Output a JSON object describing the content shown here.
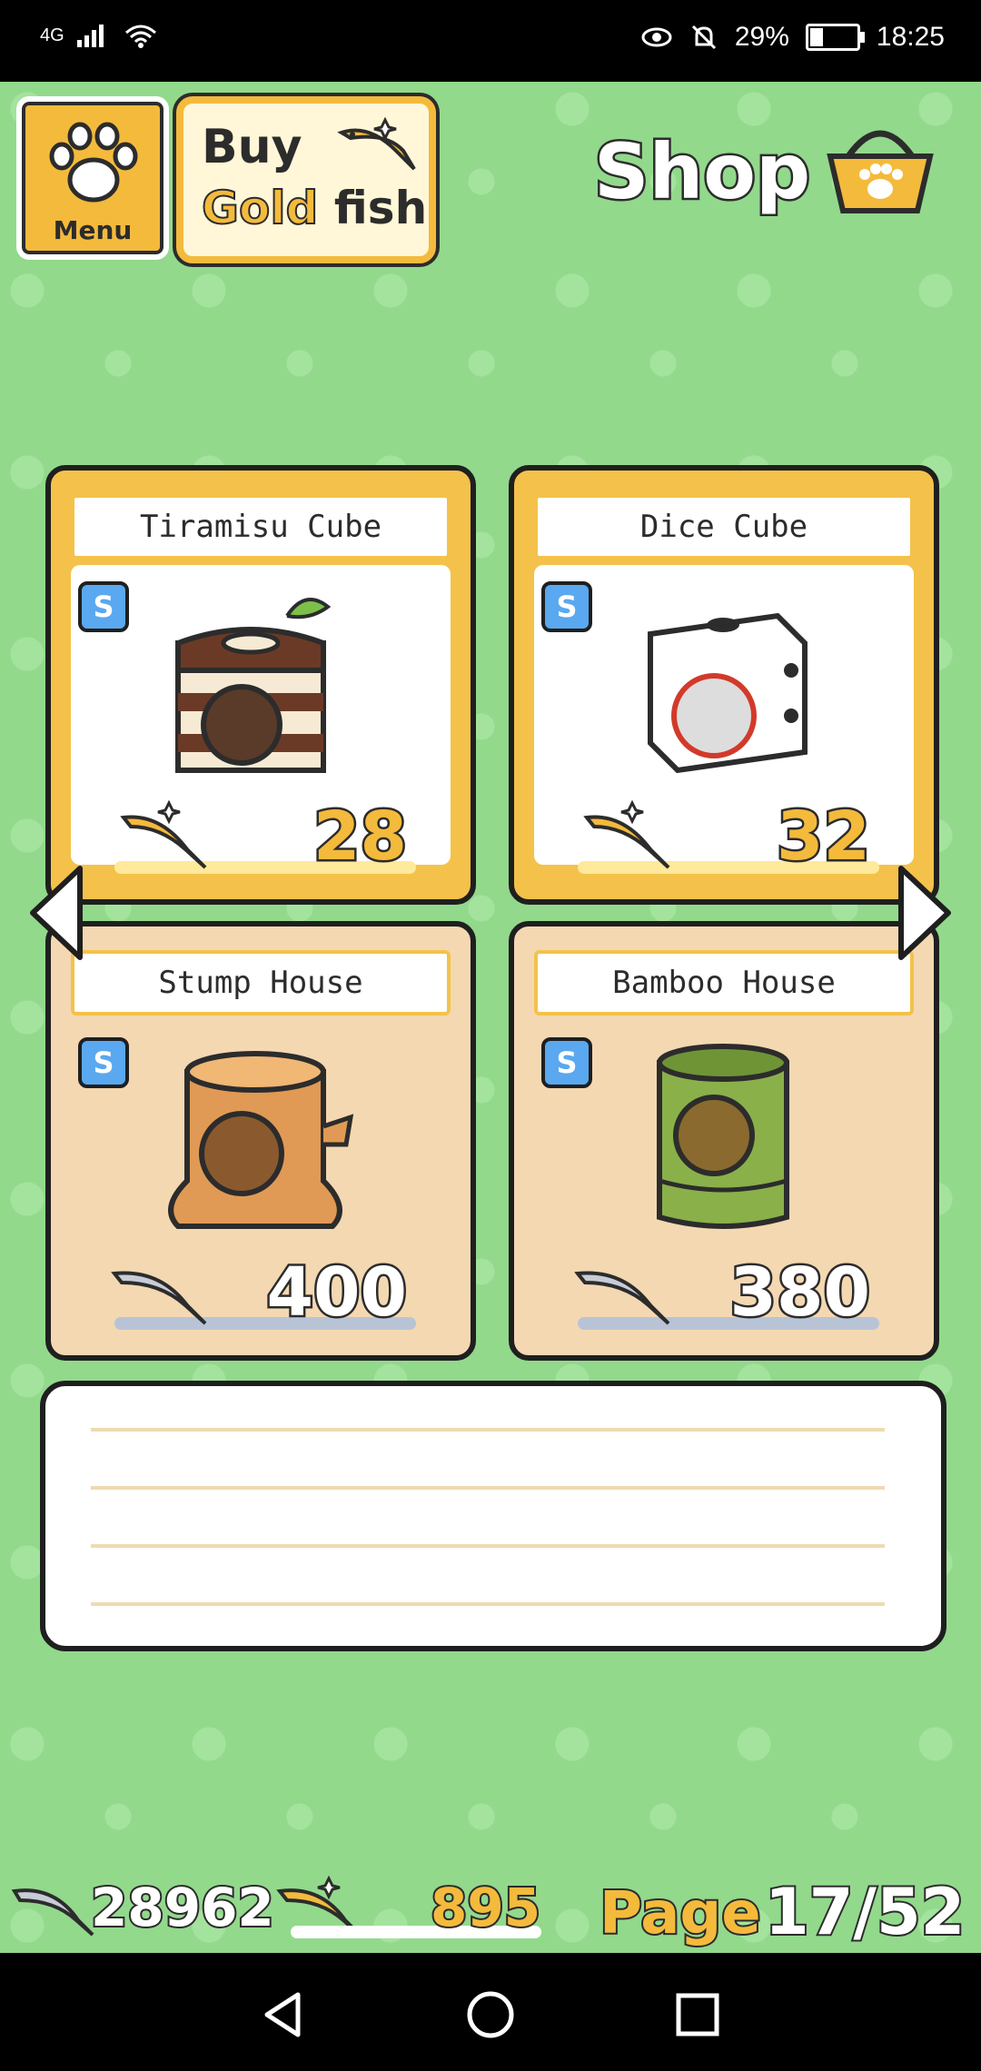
{
  "status_bar": {
    "network": "4G",
    "battery_percent": "29%",
    "battery_level": 0.29,
    "time": "18:25",
    "icons": [
      "signal-icon",
      "wifi-icon",
      "eye-icon",
      "mute-bell-icon",
      "battery-icon"
    ]
  },
  "header": {
    "menu_label": "Menu",
    "buy_line1": "Buy",
    "buy_gold": "Gold",
    "buy_fish": "fish",
    "title": "Shop"
  },
  "items": [
    {
      "name": "Tiramisu Cube",
      "badge": "S",
      "price": "28",
      "currency": "gold-fish",
      "tier": "gold"
    },
    {
      "name": "Dice Cube",
      "badge": "S",
      "price": "32",
      "currency": "gold-fish",
      "tier": "gold"
    },
    {
      "name": "Stump House",
      "badge": "S",
      "price": "400",
      "currency": "silver-fish",
      "tier": "normal"
    },
    {
      "name": "Bamboo House",
      "badge": "S",
      "price": "380",
      "currency": "silver-fish",
      "tier": "normal"
    }
  ],
  "footer": {
    "silver_fish": "28962",
    "gold_fish": "895",
    "page_label": "Page",
    "page_value": "17/52"
  },
  "colors": {
    "background": "#92d98c",
    "gold": "#f4ba3c",
    "card_normal": "#f3d8b2",
    "outline": "#2c2c2c"
  }
}
